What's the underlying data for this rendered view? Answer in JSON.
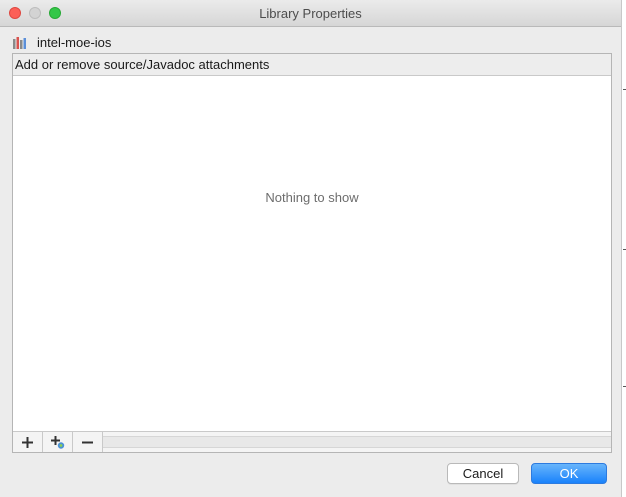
{
  "window": {
    "title": "Library Properties"
  },
  "library": {
    "name": "intel-moe-ios",
    "icon": "library-icon"
  },
  "panel": {
    "header": "Add or remove source/Javadoc attachments",
    "empty_text": "Nothing to show",
    "toolbar": [
      {
        "name": "add",
        "icon": "plus-icon"
      },
      {
        "name": "add-url",
        "icon": "plus-globe-icon"
      },
      {
        "name": "remove",
        "icon": "minus-icon"
      }
    ]
  },
  "buttons": {
    "cancel": "Cancel",
    "ok": "OK"
  },
  "colors": {
    "accent": "#1a82fb",
    "close": "#fc5f57",
    "zoom": "#33c748"
  }
}
